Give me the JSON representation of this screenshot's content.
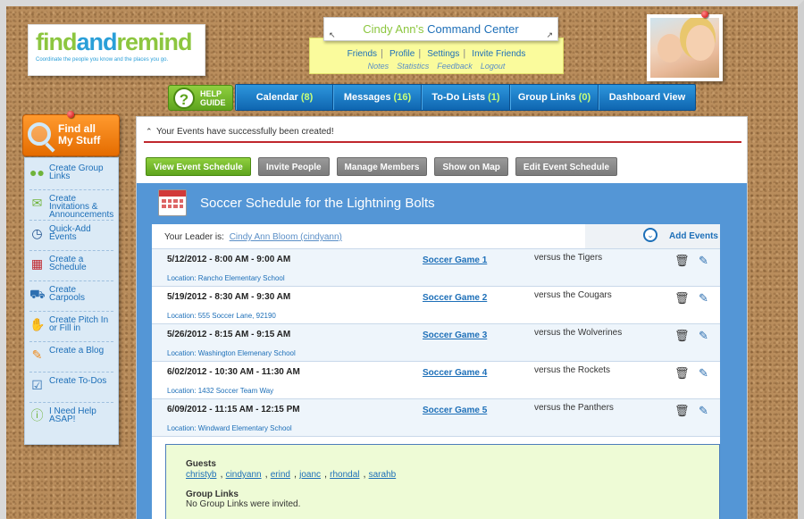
{
  "logo": {
    "find": "find",
    "and": "and",
    "remind": "remind",
    "tagline": "Coordinate the people you know and the places you go."
  },
  "command_center": {
    "name": "Cindy Ann's",
    "rest": " Command Center",
    "links": [
      "Friends",
      "Profile",
      "Settings",
      "Invite Friends"
    ],
    "sublinks": [
      "Notes",
      "Statistics",
      "Feedback",
      "Logout"
    ]
  },
  "help_guide": {
    "line1": "HELP",
    "line2": "GUIDE"
  },
  "nav": [
    {
      "label": "Calendar",
      "count": "(8)"
    },
    {
      "label": "Messages",
      "count": "(16)"
    },
    {
      "label": "To-Do Lists",
      "count": "(1)"
    },
    {
      "label": "Group Links",
      "count": "(0)"
    },
    {
      "label": "Dashboard View",
      "count": ""
    }
  ],
  "find_tab": {
    "line1": "Find all",
    "line2": "My Stuff"
  },
  "sidebar": [
    {
      "label": "Create Group Links",
      "icon": "people-icon"
    },
    {
      "label": "Create Invitations & Announcements",
      "icon": "envelope-icon"
    },
    {
      "label": "Quick-Add Events",
      "icon": "clock-icon"
    },
    {
      "label": "Create a Schedule",
      "icon": "calendar-icon"
    },
    {
      "label": "Create Carpools",
      "icon": "car-icon"
    },
    {
      "label": "Create Pitch In or Fill in",
      "icon": "hands-icon"
    },
    {
      "label": "Create a Blog",
      "icon": "pencil-icon"
    },
    {
      "label": "Create To-Dos",
      "icon": "checkbox-icon"
    },
    {
      "label": "I Need Help ASAP!",
      "icon": "help-icon"
    }
  ],
  "alert": "Your Events have successfully been created!",
  "buttons": [
    "View Event Schedule",
    "Invite People",
    "Manage Members",
    "Show on Map",
    "Edit Event Schedule"
  ],
  "schedule": {
    "title": "Soccer Schedule for the Lightning Bolts",
    "leader_label": "Your Leader is:",
    "leader_name": "Cindy Ann Bloom (cindyann)",
    "add_events": "Add Events",
    "events": [
      {
        "date": "5/12/2012 - 8:00 AM - 9:00 AM",
        "name": "Soccer Game 1",
        "vs": "versus the Tigers",
        "location": "Location: Rancho Elementary School"
      },
      {
        "date": "5/19/2012 - 8:30 AM - 9:30 AM",
        "name": "Soccer Game 2",
        "vs": "versus the Cougars",
        "location": "Location: 555 Soccer Lane, 92190"
      },
      {
        "date": "5/26/2012 - 8:15 AM - 9:15 AM",
        "name": "Soccer Game 3",
        "vs": "versus the Wolverines",
        "location": "Location: Washington Elemenary School"
      },
      {
        "date": "6/02/2012 - 10:30 AM - 11:30 AM",
        "name": "Soccer Game 4",
        "vs": "versus the Rockets",
        "location": "Location: 1432 Soccer Team Way"
      },
      {
        "date": "6/09/2012 - 11:15 AM - 12:15 PM",
        "name": "Soccer Game 5",
        "vs": "versus the Panthers",
        "location": "Location: Windward Elementary School"
      }
    ],
    "guests_label": "Guests",
    "guests": [
      "christyb",
      "cindyann",
      "erind",
      "joanc",
      "rhondal",
      "sarahb"
    ],
    "group_links_label": "Group Links",
    "group_links_text": "No Group Links were invited."
  }
}
